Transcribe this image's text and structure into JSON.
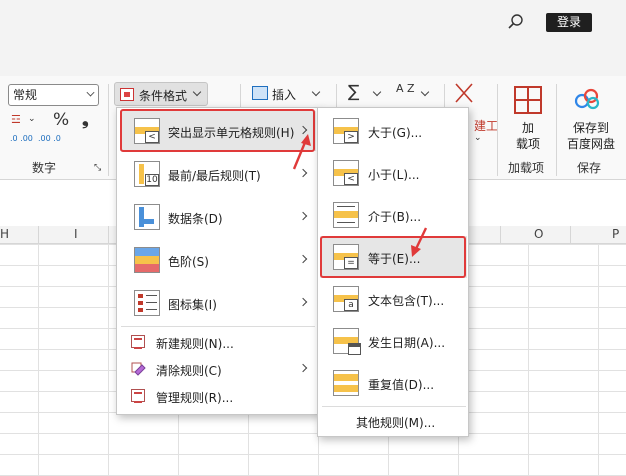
{
  "titlebar": {
    "login_label": "登录"
  },
  "ribbon": {
    "number_format_value": "常规",
    "number_group_label": "数字",
    "percent_symbol": "%",
    "comma_symbol": "❟",
    "dec_increase": ".0 .00",
    "dec_decrease": ".00 .0",
    "conditional_format_label": "条件格式",
    "insert_label": "插入",
    "sigma_symbol": "∑",
    "sort_symbol": "A Z",
    "build_label": "建工",
    "addin_label_1": "加",
    "addin_label_2": "载项",
    "addin_group_label": "加载项",
    "save_label_1": "保存到",
    "save_label_2": "百度网盘",
    "save_group_label": "保存"
  },
  "sheet": {
    "col_h": "H",
    "col_i": "I",
    "col_o": "O",
    "col_p": "P"
  },
  "menu1": {
    "items": [
      {
        "label": "突出显示单元格规则(H)"
      },
      {
        "label": "最前/最后规则(T)"
      },
      {
        "label": "数据条(D)"
      },
      {
        "label": "色阶(S)"
      },
      {
        "label": "图标集(I)"
      },
      {
        "label": "新建规则(N)..."
      },
      {
        "label": "清除规则(C)"
      },
      {
        "label": "管理规则(R)..."
      }
    ]
  },
  "menu2": {
    "items": [
      {
        "label": "大于(G)...",
        "sym": ">"
      },
      {
        "label": "小于(L)...",
        "sym": "<"
      },
      {
        "label": "介于(B)...",
        "sym": ""
      },
      {
        "label": "等于(E)...",
        "sym": "="
      },
      {
        "label": "文本包含(T)...",
        "sym": "a"
      },
      {
        "label": "发生日期(A)...",
        "sym": ""
      },
      {
        "label": "重复值(D)...",
        "sym": ""
      }
    ],
    "more_label": "其他规则(M)..."
  },
  "menu1_icon_sym": "<",
  "menu1_topn_sym": "10",
  "colors": {
    "highlight_red": "#e03a3a",
    "accent_yellow": "#f6c24a"
  }
}
